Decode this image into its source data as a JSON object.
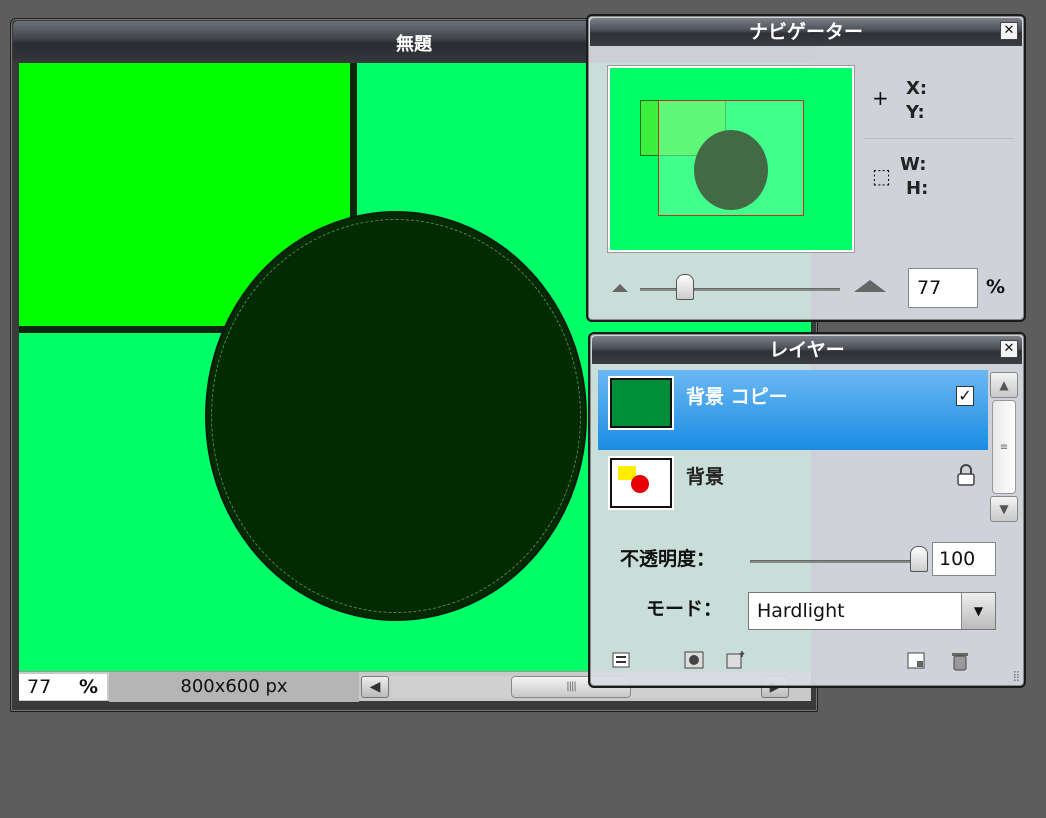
{
  "document": {
    "title": "無題",
    "zoom_value": "77",
    "zoom_unit": "%",
    "size": "800x600 px",
    "hscroll_left_icon": "◀",
    "hscroll_right_icon": "▶",
    "hscroll_grip": "||||"
  },
  "navigator": {
    "title": "ナビゲーター",
    "close_icon": "✕",
    "x_label": "X:",
    "y_label": "Y:",
    "w_label": "W:",
    "h_label": "H:",
    "zoom_value": "77",
    "zoom_unit": "%"
  },
  "layers": {
    "title": "レイヤー",
    "close_icon": "✕",
    "items": [
      {
        "name": "背景 コピー",
        "visible_check": "✓",
        "selected": true,
        "thumb_color": "#008f38"
      },
      {
        "name": "背景",
        "lock_icon": "🔒",
        "selected": false
      }
    ],
    "opacity_label": "不透明度：",
    "opacity_value": "100",
    "mode_label": "モード：",
    "mode_value": "Hardlight",
    "mode_arrow": "▼",
    "scroll_up": "▲",
    "scroll_down": "▼",
    "scroll_grip": "≡"
  },
  "colors": {
    "canvas_bg": "#00ff66",
    "rect_bright": "#00ff00",
    "ellipse": "#022b02",
    "selected_layer": "#1a8ce3"
  }
}
